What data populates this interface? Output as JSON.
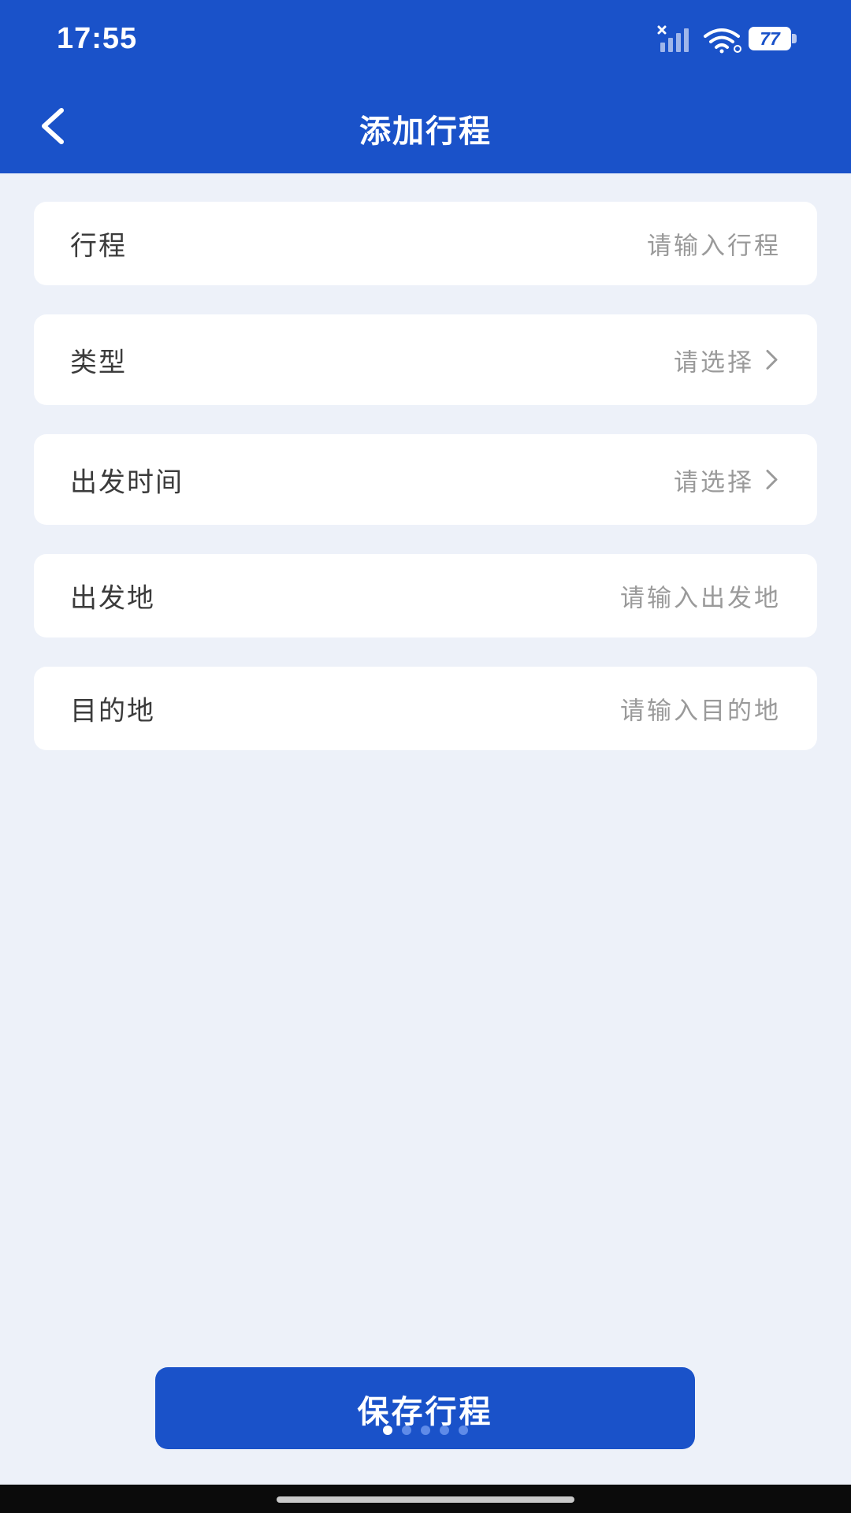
{
  "status_bar": {
    "time": "17:55",
    "battery": "77",
    "icons": [
      "signal-icon",
      "wifi-icon",
      "battery-icon"
    ]
  },
  "header": {
    "title": "添加行程",
    "back_icon": "chevron-left-icon"
  },
  "form": {
    "rows": [
      {
        "label": "行程",
        "value": "请输入行程",
        "type": "input"
      },
      {
        "label": "类型",
        "value": "请选择",
        "type": "select"
      },
      {
        "label": "出发时间",
        "value": "请选择",
        "type": "select"
      },
      {
        "label": "出发地",
        "value": "请输入出发地",
        "type": "input"
      },
      {
        "label": "目的地",
        "value": "请输入目的地",
        "type": "input"
      }
    ]
  },
  "footer": {
    "save_label": "保存行程",
    "page_dots": {
      "count": 5,
      "active": 1
    }
  },
  "colors": {
    "primary": "#1a52c9",
    "background": "#edf1f9",
    "card": "#ffffff",
    "label_text": "#3b3b3b",
    "placeholder_text": "#9a9a9a"
  }
}
